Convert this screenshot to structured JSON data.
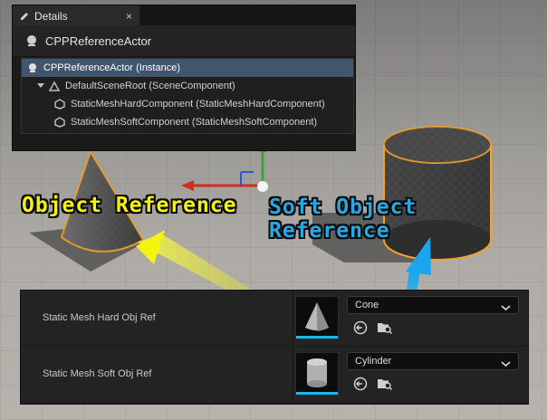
{
  "details": {
    "tab_label": "Details",
    "tab_close": "×",
    "actor_name": "CPPReferenceActor",
    "tree": [
      {
        "label": "CPPReferenceActor (Instance)",
        "selected": true
      },
      {
        "label": "DefaultSceneRoot (SceneComponent)"
      },
      {
        "label": "StaticMeshHardComponent (StaticMeshHardComponent)"
      },
      {
        "label": "StaticMeshSoftComponent (StaticMeshSoftComponent)"
      }
    ]
  },
  "annotations": {
    "hard_label": "Object Reference",
    "soft_label": "Soft Object Reference",
    "hard_color": "#f5f210",
    "soft_color": "#27a8e6"
  },
  "properties": [
    {
      "label": "Static Mesh Hard Obj Ref",
      "value": "Cone",
      "thumbnail": "cone-mesh"
    },
    {
      "label": "Static Mesh Soft Obj Ref",
      "value": "Cylinder",
      "thumbnail": "cylinder-mesh"
    }
  ],
  "icons": {
    "use_selected": "arrow-left-circle-icon",
    "browse": "folder-search-icon",
    "dropdown": "chevron-down-icon"
  }
}
